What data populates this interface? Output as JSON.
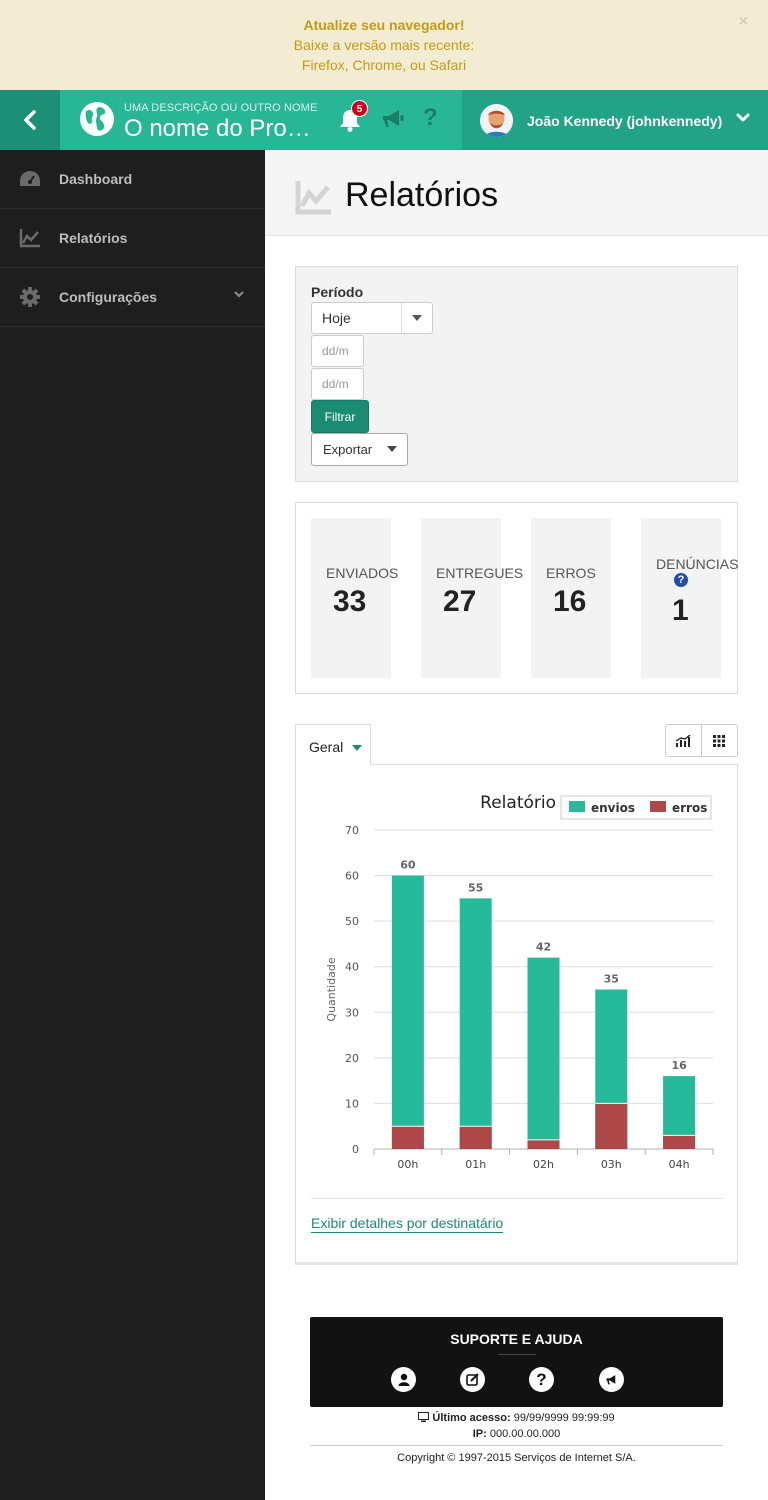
{
  "banner": {
    "title": "Atualize seu navegador!",
    "line1": "Baixe a versão mais recente:",
    "line2": "Firefox, Chrome, ou Safari",
    "close": "×"
  },
  "header": {
    "subtitle": "UMA DESCRIÇÃO OU OUTRO NOME",
    "title": "O nome do Pro…",
    "notifications": "5",
    "help": "?",
    "user_name": "João Kennedy (johnkennedy)"
  },
  "sidebar": {
    "items": [
      {
        "label": "Dashboard",
        "icon": "dashboard-icon"
      },
      {
        "label": "Relatórios",
        "icon": "line-chart-icon"
      },
      {
        "label": "Configurações",
        "icon": "gear-icon"
      }
    ]
  },
  "page": {
    "title": "Relatórios"
  },
  "filter": {
    "period_label": "Período",
    "period_value": "Hoje",
    "date_from_placeholder": "dd/m",
    "date_to_placeholder": "dd/m",
    "filter_button": "Filtrar",
    "export_button": "Exportar"
  },
  "stats": [
    {
      "label": "ENVIADOS",
      "value": "33"
    },
    {
      "label": "ENTREGUES",
      "value": "27"
    },
    {
      "label": "ERROS",
      "value": "16"
    },
    {
      "label": "DENÚNCIAS",
      "value": "1",
      "help": "?"
    }
  ],
  "tabs": {
    "active": "Geral"
  },
  "chart_data": {
    "type": "bar",
    "stacked": true,
    "title": "Relatório",
    "ylabel": "Quantidade",
    "xlabel": "",
    "categories": [
      "00h",
      "01h",
      "02h",
      "03h",
      "04h"
    ],
    "series": [
      {
        "name": "envios",
        "color": "#26b99a",
        "values": [
          60,
          55,
          42,
          35,
          16
        ]
      },
      {
        "name": "erros",
        "color": "#ae4747",
        "values": [
          5,
          5,
          2,
          10,
          3
        ]
      }
    ],
    "data_labels": [
      "60",
      "55",
      "42",
      "35",
      "16"
    ],
    "ylim": [
      0,
      70
    ],
    "yticks": [
      "0",
      "10",
      "20",
      "30",
      "40",
      "50",
      "60",
      "70"
    ],
    "grid": true,
    "legend": "top-right"
  },
  "details_link": "Exibir detalhes por destinatário",
  "support": {
    "title": "SUPORTE E AJUDA",
    "last_access_label": "Último acesso:",
    "last_access_value": "99/99/9999 99:99:99",
    "ip_label": "IP:",
    "ip_value": "000.00.00.000",
    "copyright": "Copyright © 1997-2015 Serviços de Internet S/A."
  },
  "colors": {
    "primary": "#28b796",
    "primary_dark": "#1b8c73",
    "error": "#ae4747",
    "sidebar": "#1e1e1e",
    "warning_text": "#c69a16"
  }
}
